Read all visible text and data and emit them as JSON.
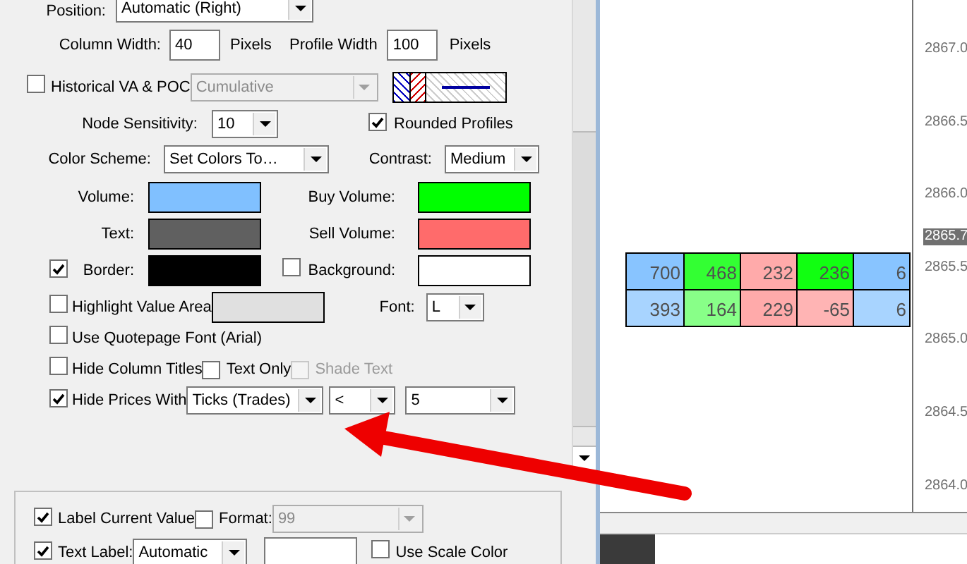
{
  "dialog": {
    "position": {
      "label": "Position:",
      "value": "Automatic (Right)"
    },
    "column_width": {
      "label": "Column Width:",
      "value": "40",
      "unit": "Pixels"
    },
    "profile_width": {
      "label": "Profile Width",
      "value": "100",
      "unit": "Pixels"
    },
    "historical_va_poc": {
      "label": "Historical VA & POC",
      "checked": false,
      "value": "Cumulative",
      "disabled": true
    },
    "node_sensitivity": {
      "label": "Node Sensitivity:",
      "value": "10"
    },
    "rounded_profiles": {
      "label": "Rounded Profiles",
      "checked": true
    },
    "color_scheme": {
      "label": "Color Scheme:",
      "value": "Set Colors To…"
    },
    "contrast": {
      "label": "Contrast:",
      "value": "Medium"
    },
    "volume": {
      "label": "Volume:",
      "color": "#80c0ff"
    },
    "buy_volume": {
      "label": "Buy Volume:",
      "color": "#00ff00"
    },
    "text": {
      "label": "Text:",
      "color": "#606060"
    },
    "sell_volume": {
      "label": "Sell Volume:",
      "color": "#ff6b6b"
    },
    "border": {
      "label": "Border:",
      "checked": true,
      "color": "#000000"
    },
    "background": {
      "label": "Background:",
      "checked": false,
      "color": "#ffffff"
    },
    "highlight_value_area": {
      "label": "Highlight Value Area",
      "checked": false,
      "color": "#e0e0e0"
    },
    "font": {
      "label": "Font:",
      "value": "L"
    },
    "use_quotepage_font": {
      "label": "Use Quotepage Font (Arial)",
      "checked": false
    },
    "hide_column_titles": {
      "label": "Hide Column Titles",
      "checked": false
    },
    "text_only": {
      "label": "Text Only",
      "checked": false
    },
    "shade_text": {
      "label": "Shade Text",
      "checked": false,
      "disabled": true
    },
    "hide_prices_with": {
      "label": "Hide Prices With",
      "checked": true,
      "values": [
        "Ticks (Trades)",
        "<",
        "5"
      ]
    },
    "label_group": {
      "label_current_value": {
        "label": "Label Current Value",
        "checked": true
      },
      "format": {
        "label": "Format:",
        "checked": false,
        "value": "99",
        "disabled": true
      },
      "text_label": {
        "label": "Text Label:",
        "checked": true,
        "value": "Automatic"
      },
      "use_scale_color": {
        "label": "Use Scale Color",
        "checked": false
      }
    }
  },
  "chart": {
    "price_axis": [
      "2867.0",
      "2866.5",
      "2866.0",
      "2865.5",
      "2865.0",
      "2864.5",
      "2864.0"
    ],
    "current_price": "2865.7",
    "table": {
      "rows": [
        [
          {
            "text": "700",
            "color": "#88c4ff"
          },
          {
            "text": "468",
            "color": "#33ff33"
          },
          {
            "text": "232",
            "color": "#ffaaaa"
          },
          {
            "text": "236",
            "color": "#11ff11"
          },
          {
            "text": "6",
            "color": "#88c4ff"
          }
        ],
        [
          {
            "text": "393",
            "color": "#a8d4ff"
          },
          {
            "text": "164",
            "color": "#88ff88"
          },
          {
            "text": "229",
            "color": "#ffaaaa"
          },
          {
            "text": "-65",
            "color": "#ffb4b4"
          },
          {
            "text": "6",
            "color": "#a8d4ff"
          }
        ]
      ]
    }
  }
}
